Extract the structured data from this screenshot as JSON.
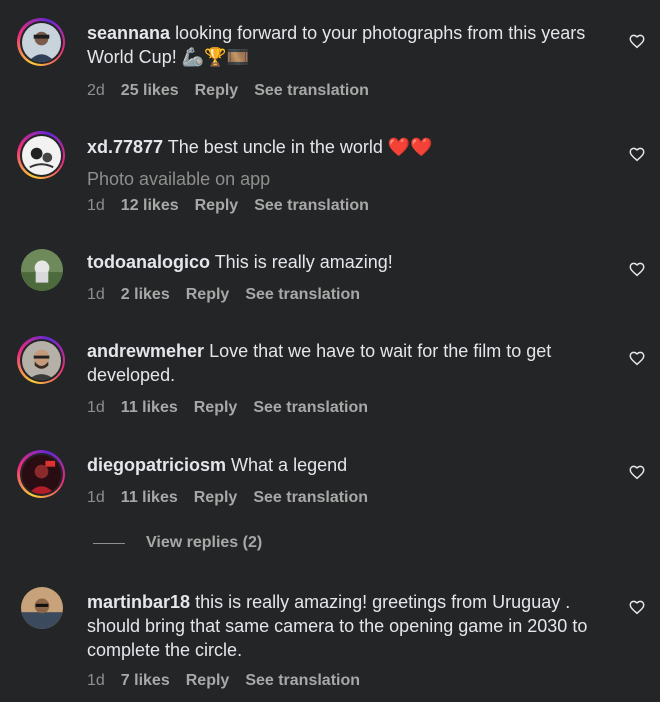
{
  "comments": [
    {
      "username": "seannana",
      "text": "looking forward to your photographs from this years World Cup! 🦾🏆🎞️",
      "time": "2d",
      "likes": "25 likes",
      "reply": "Reply",
      "translate": "See translation"
    },
    {
      "username": "xd.77877",
      "text": "The best uncle in the world ❤️❤️",
      "note": "Photo available on app",
      "time": "1d",
      "likes": "12 likes",
      "reply": "Reply",
      "translate": "See translation"
    },
    {
      "username": "todoanalogico",
      "text": "This is really amazing!",
      "time": "1d",
      "likes": "2 likes",
      "reply": "Reply",
      "translate": "See translation"
    },
    {
      "username": "andrewmeher",
      "text": "Love that we have to wait for the film to get developed.",
      "time": "1d",
      "likes": "11 likes",
      "reply": "Reply",
      "translate": "See translation"
    },
    {
      "username": "diegopatriciosm",
      "text": "What a legend",
      "time": "1d",
      "likes": "11 likes",
      "reply": "Reply",
      "translate": "See translation"
    },
    {
      "username": "martinbar18",
      "text": "this is really amazing! greetings from Uruguay . should bring that same camera to the opening game in 2030 to complete the circle.",
      "time": "1d",
      "likes": "7 likes",
      "reply": "Reply",
      "translate": "See translation"
    }
  ],
  "view_replies": "View replies (2)",
  "icons": {
    "like": "heart-outline-icon"
  },
  "colors": {
    "background": "#242526",
    "text": "#e4e6eb",
    "muted": "#8e8e8e"
  }
}
